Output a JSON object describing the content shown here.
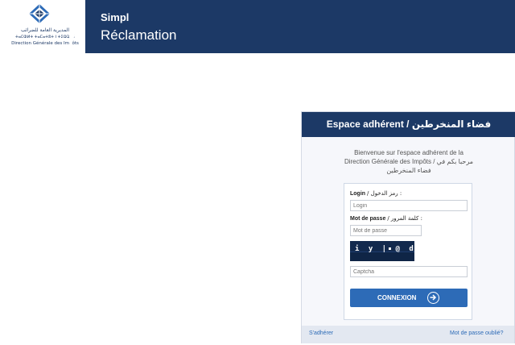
{
  "header": {
    "logo_ar": "المديرية العامة للضرائب",
    "logo_tifinagh": "ⵜⴰⵎⵀⵍⵜ ⵜⴰⵎⴰⵜⵓⵜ ⵏ ⵜⵉⵛⵕⴰⴹ",
    "logo_fr": "Direction Générale des Impôts",
    "app_name": "Simpl",
    "app_subtitle": "Réclamation",
    "bg_color": "#1c3966"
  },
  "login_panel": {
    "title": "Espace adhérent / فضاء المنخرطين",
    "welcome_line1": "Bienvenue sur l'espace adhérent de la",
    "welcome_line2": "Direction Générale des Impôts / مرحبا بكم في",
    "welcome_line3": "فضاء المنخرطين",
    "login_label": "Login",
    "login_label_ar": "/ رمز الدخول :",
    "login_placeholder": "Login",
    "password_label": "Mot de passe",
    "password_label_ar": "/ كلمة المرور :",
    "password_placeholder": "Mot de passe",
    "captcha_text": "i y | @ d p",
    "captcha_placeholder": "Captcha",
    "submit_label": "CONNEXION",
    "submit_icon": "arrow-right-circle-icon",
    "register_link": "S'adhérer",
    "forgot_link": "Mot de passe oublié?",
    "accent_color": "#2d6bb7"
  }
}
